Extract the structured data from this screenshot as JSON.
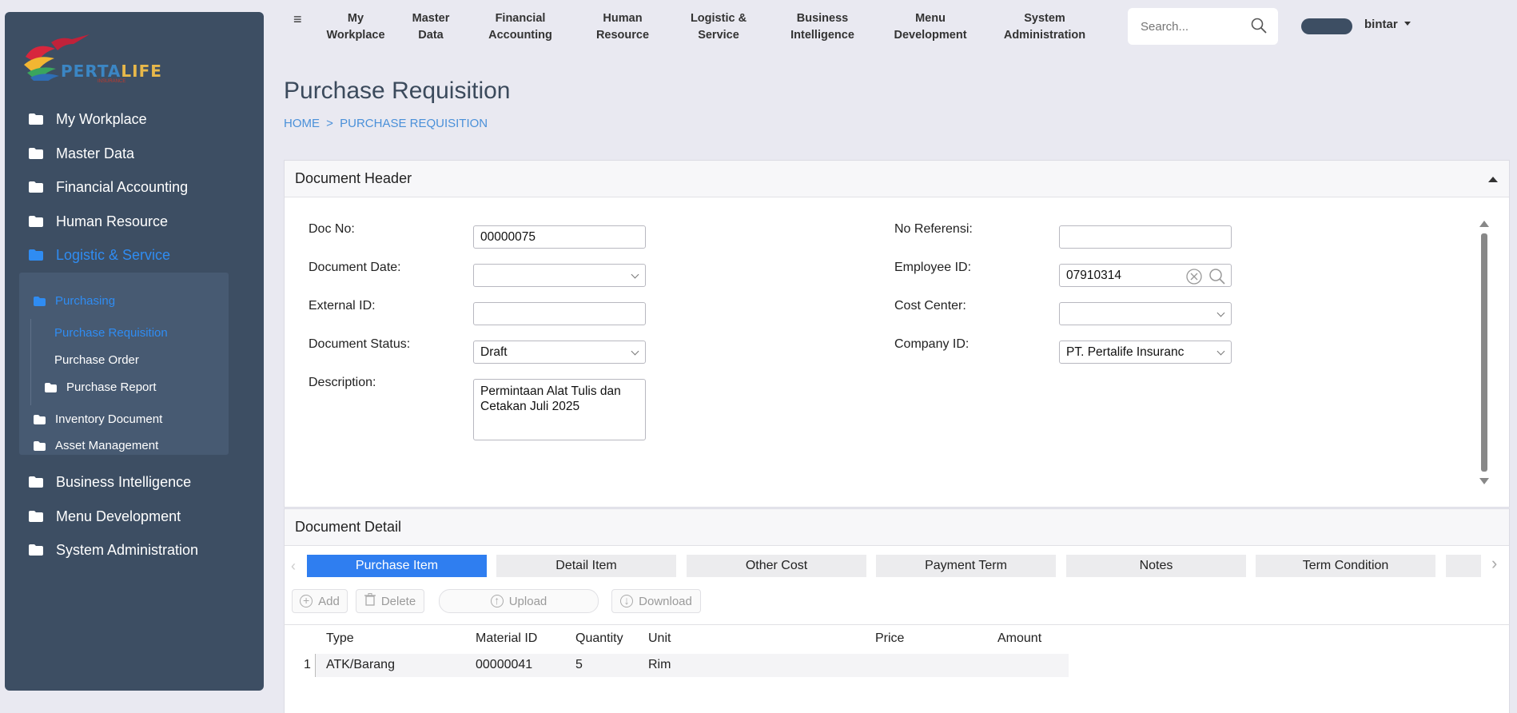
{
  "sidebar": {
    "logo_main": "PERTA",
    "logo_accent": "LIFE",
    "logo_sub": "INSURANCE",
    "items": [
      {
        "label": "My Workplace"
      },
      {
        "label": "Master Data"
      },
      {
        "label": "Financial Accounting"
      },
      {
        "label": "Human Resource"
      },
      {
        "label": "Logistic & Service"
      },
      {
        "label": "Business Intelligence"
      },
      {
        "label": "Menu Development"
      },
      {
        "label": "System Administration"
      }
    ],
    "sub": {
      "purchasing": "Purchasing",
      "purchase_requisition": "Purchase Requisition",
      "purchase_order": "Purchase Order",
      "purchase_report": "Purchase Report",
      "inventory_document": "Inventory Document",
      "asset_management": "Asset Management"
    }
  },
  "topnav": [
    {
      "line1": "My",
      "line2": "Workplace"
    },
    {
      "line1": "Master",
      "line2": "Data"
    },
    {
      "line1": "Financial",
      "line2": "Accounting"
    },
    {
      "line1": "Human",
      "line2": "Resource"
    },
    {
      "line1": "Logistic &",
      "line2": "Service"
    },
    {
      "line1": "Business",
      "line2": "Intelligence"
    },
    {
      "line1": "Menu",
      "line2": "Development"
    },
    {
      "line1": "System",
      "line2": "Administration"
    }
  ],
  "search": {
    "placeholder": "Search..."
  },
  "user": {
    "name": "bintar"
  },
  "page": {
    "title": "Purchase Requisition",
    "breadcrumb_home": "HOME",
    "breadcrumb_sep": ">",
    "breadcrumb_current": "PURCHASE REQUISITION"
  },
  "header_card": {
    "title": "Document Header",
    "fields": {
      "doc_no_label": "Doc No:",
      "doc_no": "00000075",
      "doc_date_label": "Document Date:",
      "doc_date": "",
      "external_id_label": "External ID:",
      "external_id": "",
      "doc_status_label": "Document Status:",
      "doc_status": "Draft",
      "description_label": "Description:",
      "description": "Permintaan Alat Tulis dan Cetakan Juli 2025",
      "no_ref_label": "No Referensi:",
      "no_ref": "",
      "employee_id_label": "Employee ID:",
      "employee_id": "07910314",
      "cost_center_label": "Cost Center:",
      "cost_center": "",
      "company_id_label": "Company ID:",
      "company_id": "PT. Pertalife Insuranc"
    }
  },
  "detail_card": {
    "title": "Document Detail",
    "tabs": [
      "Purchase Item",
      "Detail Item",
      "Other Cost",
      "Payment Term",
      "Notes",
      "Term Condition"
    ],
    "toolbar": {
      "add": "Add",
      "delete": "Delete",
      "upload": "Upload",
      "download": "Download"
    },
    "columns": [
      "Type",
      "Material ID",
      "Quantity",
      "Unit",
      "Price",
      "Amount"
    ],
    "rows": [
      {
        "no": "1",
        "type": "ATK/Barang",
        "material_id": "00000041",
        "quantity": "5",
        "unit": "Rim",
        "price": "",
        "amount": ""
      }
    ]
  }
}
